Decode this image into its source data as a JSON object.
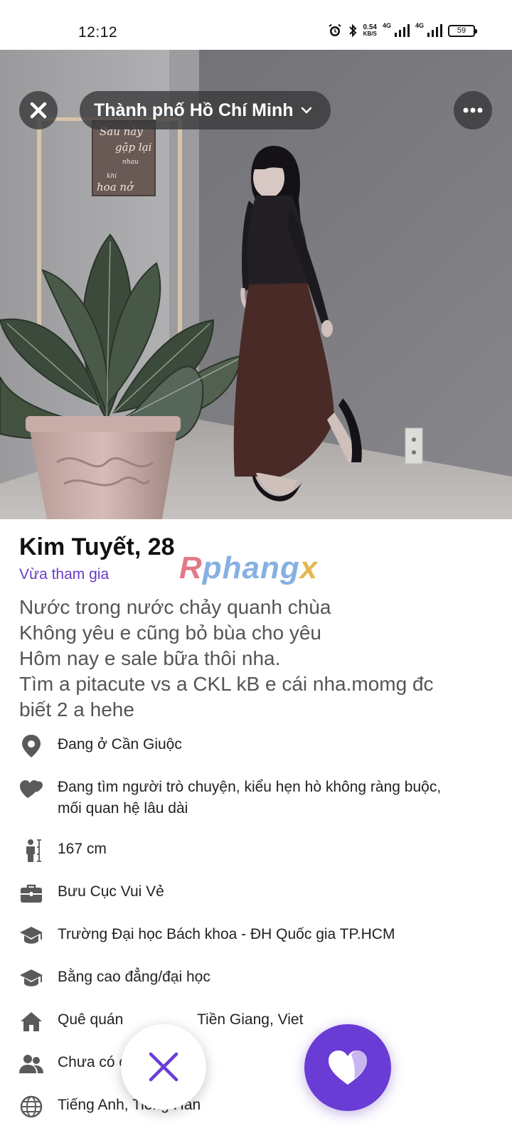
{
  "status_bar": {
    "time": "12:12",
    "net_speed_value": "0.54",
    "net_speed_unit": "KB/S",
    "net_type_1": "4G",
    "net_type_2": "4G",
    "battery": "59",
    "icons": [
      "alarm-icon",
      "bluetooth-icon",
      "signal-icon",
      "signal-icon",
      "battery-icon"
    ]
  },
  "header": {
    "location": "Thành phố Hồ Chí Minh",
    "close_icon": "close-icon",
    "dropdown_icon": "chevron-down-icon",
    "more_icon": "more-options-icon"
  },
  "photo": {
    "sign_text_1": "Sau này",
    "sign_text_2": "gặp lại",
    "sign_text_3": "nhau",
    "sign_text_4": "khi",
    "sign_text_5": "hoa nở"
  },
  "profile": {
    "name_age": "Kim Tuyết, 28",
    "joined": "Vừa tham gia",
    "watermark_r": "R",
    "watermark_mid": "phang",
    "watermark_x": "x",
    "bio_lines": [
      "Nước trong nước chảy quanh chùa",
      "Không yêu e cũng bỏ bùa cho yêu",
      "Hôm nay e sale bữa thôi nha.",
      "Tìm a pitacute vs a CKL kB e cái nha.momg đc",
      "biết 2 a hehe"
    ]
  },
  "details": [
    {
      "icon": "location-pin-icon",
      "text": "Đang ở Cần Giuộc"
    },
    {
      "icon": "hearts-icon",
      "text": "Đang tìm người trò chuyện, kiểu hẹn hò không ràng buộc,",
      "text2": "mối quan hệ lâu dài"
    },
    {
      "icon": "height-icon",
      "text": "167 cm"
    },
    {
      "icon": "briefcase-icon",
      "text": "Bưu Cục Vui Vẻ"
    },
    {
      "icon": "graduation-cap-icon",
      "text": "Trường Đại học Bách khoa - ĐH Quốc gia TP.HCM"
    },
    {
      "icon": "graduation-cap-icon",
      "text": "Bằng cao đẳng/đại học"
    },
    {
      "icon": "home-icon",
      "text": "Quê quán",
      "text_right": "Tiền Giang, Viet"
    },
    {
      "icon": "people-icon",
      "text": "Chưa có c"
    },
    {
      "icon": "globe-icon",
      "text": "Tiếng Anh, Tiếng Hàn"
    }
  ],
  "actions": {
    "dislike_icon": "x-icon",
    "like_icon": "heart-icon"
  },
  "colors": {
    "accent": "#6a3cd6",
    "joined_text": "#6a3cc6",
    "icon_gray": "#5a5a5a"
  }
}
